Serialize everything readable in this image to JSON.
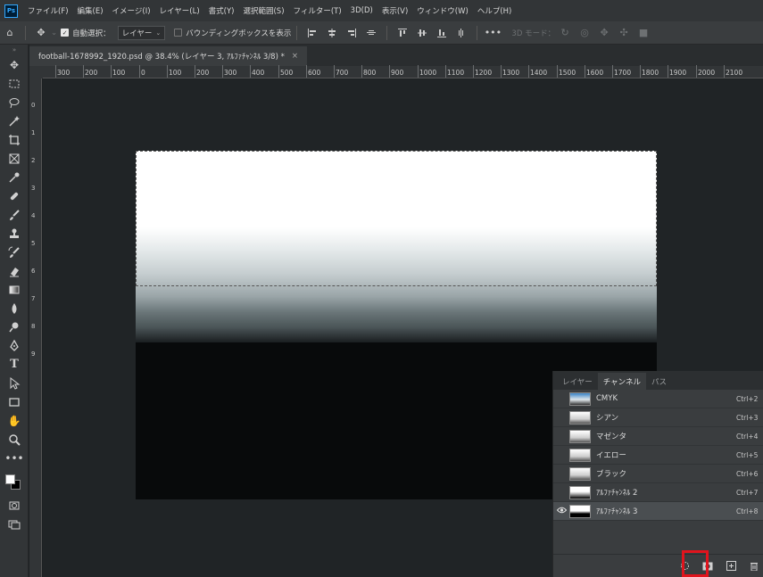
{
  "menu": {
    "items": [
      "ファイル(F)",
      "編集(E)",
      "イメージ(I)",
      "レイヤー(L)",
      "書式(Y)",
      "選択範囲(S)",
      "フィルター(T)",
      "3D(D)",
      "表示(V)",
      "ウィンドウ(W)",
      "ヘルプ(H)"
    ]
  },
  "app_logo": "Ps",
  "options": {
    "auto_select_label": "自動選択：",
    "auto_select_target": "レイヤー",
    "bounding_box_label": "バウンディングボックスを表示",
    "mode_3d_label": "3D モード："
  },
  "document": {
    "tab_title": "football-1678992_1920.psd @ 38.4% (レイヤー 3, ｱﾙﾌｧﾁｬﾝﾈﾙ 3/8) *"
  },
  "ruler": {
    "h_labels": [
      "300",
      "200",
      "100",
      "0",
      "100",
      "200",
      "300",
      "400",
      "500",
      "600",
      "700",
      "800",
      "900",
      "1000",
      "1100",
      "1200",
      "1300",
      "1400",
      "1500",
      "1600",
      "1700",
      "1800",
      "1900",
      "2000",
      "2100"
    ],
    "v_labels": [
      "0",
      "1",
      "2",
      "3",
      "4",
      "5",
      "6",
      "7",
      "8",
      "9"
    ]
  },
  "channels_panel": {
    "tabs": [
      "レイヤー",
      "チャンネル",
      "パス"
    ],
    "active_tab": "チャンネル",
    "channels": [
      {
        "name": "CMYK",
        "shortcut": "Ctrl+2",
        "visible": false,
        "selected": false
      },
      {
        "name": "シアン",
        "shortcut": "Ctrl+3",
        "visible": false,
        "selected": false
      },
      {
        "name": "マゼンタ",
        "shortcut": "Ctrl+4",
        "visible": false,
        "selected": false
      },
      {
        "name": "イエロー",
        "shortcut": "Ctrl+5",
        "visible": false,
        "selected": false
      },
      {
        "name": "ブラック",
        "shortcut": "Ctrl+6",
        "visible": false,
        "selected": false
      },
      {
        "name": "ｱﾙﾌｧﾁｬﾝﾈﾙ 2",
        "shortcut": "Ctrl+7",
        "visible": false,
        "selected": false
      },
      {
        "name": "ｱﾙﾌｧﾁｬﾝﾈﾙ 3",
        "shortcut": "Ctrl+8",
        "visible": true,
        "selected": true
      }
    ]
  },
  "colors": {
    "highlight": "#e0141d",
    "ps_blue": "#31a8ff"
  }
}
